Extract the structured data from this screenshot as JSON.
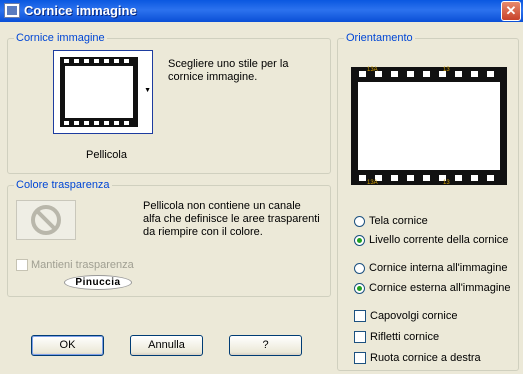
{
  "window": {
    "title": "Cornice immagine",
    "close_glyph": "✕"
  },
  "frame_group": {
    "legend": "Cornice immagine",
    "hint_line1": "Scegliere uno stile per la",
    "hint_line2": "cornice immagine.",
    "frame_name": "Pellicola"
  },
  "transparency_group": {
    "legend": "Colore trasparenza",
    "info_line1": "Pellicola non contiene un canale",
    "info_line2": "alfa che definisce le aree trasparenti",
    "info_line3": "da riempire con il colore.",
    "keep_label": "Mantieni trasparenza",
    "logo_text": "Pinuccia"
  },
  "orientation_group": {
    "legend": "Orientamento",
    "film_numbers": [
      "13A",
      "13"
    ],
    "radio_tela": "Tela cornice",
    "radio_livello": "Livello corrente della cornice",
    "radio_interna": "Cornice interna all'immagine",
    "radio_esterna": "Cornice esterna all'immagine",
    "check_capovolgi": "Capovolgi cornice",
    "check_rifletti": "Rifletti cornice",
    "check_ruota": "Ruota cornice a destra"
  },
  "buttons": {
    "ok": "OK",
    "cancel": "Annulla",
    "help": "?"
  }
}
